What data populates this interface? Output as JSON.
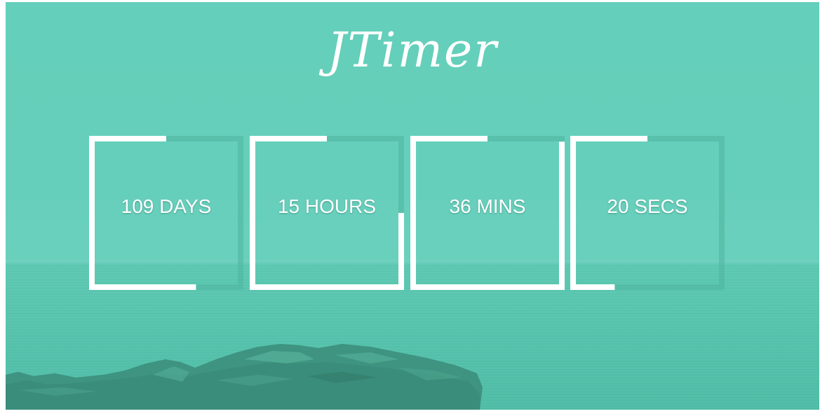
{
  "app": {
    "title": "JTimer"
  },
  "colors": {
    "background_teal": "#63cdb8",
    "progress_white": "#ffffff",
    "track_dark": "#4fb49f"
  },
  "timers": [
    {
      "label": "109 DAYS",
      "unit": "days",
      "progress": 0.55
    },
    {
      "label": "15 HOURS",
      "unit": "hours",
      "progress": 0.75
    },
    {
      "label": "36 MINS",
      "unit": "mins",
      "progress": 0.87
    },
    {
      "label": "20 SECS",
      "unit": "secs",
      "progress": 0.445
    }
  ]
}
